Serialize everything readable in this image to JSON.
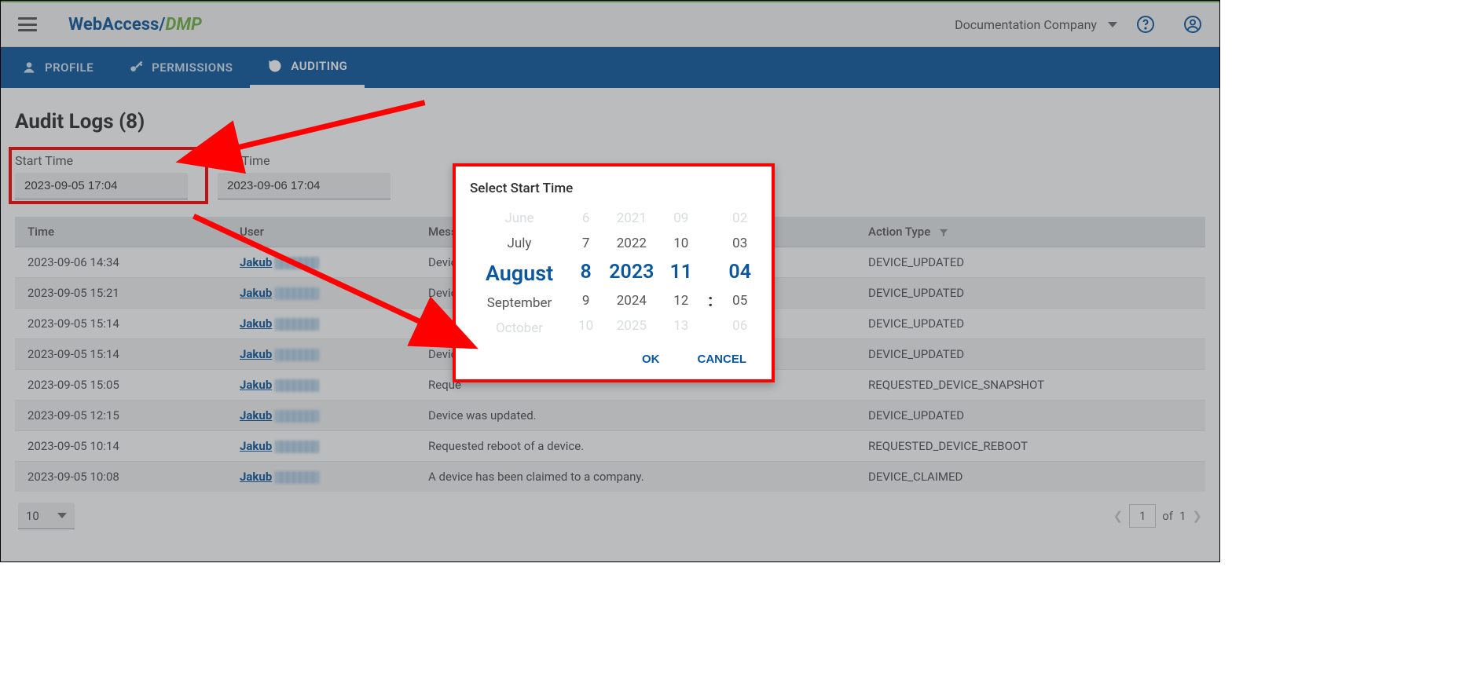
{
  "appbar": {
    "logo_wa": "WebAccess/",
    "logo_dmp": "DMP",
    "company": "Documentation Company"
  },
  "tabs": {
    "profile": "PROFILE",
    "permissions": "PERMISSIONS",
    "auditing": "AUDITING"
  },
  "page": {
    "title": "Audit Logs (8)"
  },
  "filters": {
    "start_label": "Start Time",
    "start_value": "2023-09-05 17:04",
    "end_label": "End Time",
    "end_value": "2023-09-06 17:04"
  },
  "columns": {
    "time": "Time",
    "user": "User",
    "message": "Message",
    "action": "Action Type"
  },
  "rows": [
    {
      "time": "2023-09-06 14:34",
      "user": "Jakub",
      "message": "Device",
      "action": "DEVICE_UPDATED"
    },
    {
      "time": "2023-09-05 15:21",
      "user": "Jakub",
      "message": "Device",
      "action": "DEVICE_UPDATED"
    },
    {
      "time": "2023-09-05 15:14",
      "user": "Jakub",
      "message": "Device",
      "action": "DEVICE_UPDATED"
    },
    {
      "time": "2023-09-05 15:14",
      "user": "Jakub",
      "message": "Device",
      "action": "DEVICE_UPDATED"
    },
    {
      "time": "2023-09-05 15:05",
      "user": "Jakub",
      "message": "Reque",
      "action": "REQUESTED_DEVICE_SNAPSHOT"
    },
    {
      "time": "2023-09-05 12:15",
      "user": "Jakub",
      "message": "Device was updated.",
      "action": "DEVICE_UPDATED"
    },
    {
      "time": "2023-09-05 10:14",
      "user": "Jakub",
      "message": "Requested reboot of a device.",
      "action": "REQUESTED_DEVICE_REBOOT"
    },
    {
      "time": "2023-09-05 10:08",
      "user": "Jakub",
      "message": "A device has been claimed to a company.",
      "action": "DEVICE_CLAIMED"
    }
  ],
  "footer": {
    "page_size": "10",
    "page": "1",
    "of_label": "of",
    "total": "1"
  },
  "dialog": {
    "title": "Select Start Time",
    "months": [
      "June",
      "July",
      "August",
      "September",
      "October"
    ],
    "days": [
      "6",
      "7",
      "8",
      "9",
      "10"
    ],
    "years": [
      "2021",
      "2022",
      "2023",
      "2024",
      "2025"
    ],
    "hours": [
      "09",
      "10",
      "11",
      "12",
      "13"
    ],
    "mins": [
      "02",
      "03",
      "04",
      "05",
      "06"
    ],
    "ok": "OK",
    "cancel": "CANCEL"
  }
}
